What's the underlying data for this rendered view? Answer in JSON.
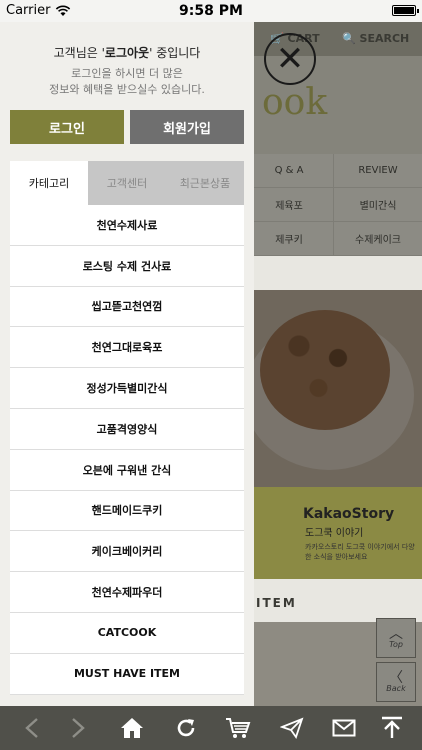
{
  "status_bar": {
    "carrier": "Carrier",
    "time": "9:58 PM"
  },
  "background_site": {
    "topbar": {
      "cart": "CART",
      "search": "SEARCH"
    },
    "logo": "ook",
    "nav_rows": [
      [
        "Q & A",
        "REVIEW"
      ],
      [
        "제육포",
        "별미간식"
      ],
      [
        "제쿠키",
        "수제케이크"
      ]
    ],
    "kakao": {
      "title": "KakaoStory",
      "subtitle": "도그쿡 이야기",
      "note": "카카오스토리 도그쿡 이야기에서 다양한 소식을 받아보세요"
    },
    "item_heading": "ITEM",
    "side_buttons": {
      "top": "Top",
      "back": "Back"
    }
  },
  "drawer": {
    "message_prefix": "고객님은 '",
    "message_bold": "로그아웃",
    "message_suffix": "' 중입니다",
    "sub_line1": "로그인을 하시면 더 많은",
    "sub_line2": "정보와 혜택을 받으실수 있습니다.",
    "login_label": "로그인",
    "join_label": "회원가입",
    "tabs": [
      {
        "label": "카테고리",
        "active": true
      },
      {
        "label": "고객센터",
        "active": false
      },
      {
        "label": "최근본상품",
        "active": false
      }
    ],
    "menu": [
      "천연수제사료",
      "로스팅 수제 건사료",
      "씹고뜯고천연껌",
      "천연그대로육포",
      "정성가득별미간식",
      "고품격영양식",
      "오븐에 구워낸 간식",
      "핸드메이드쿠키",
      "케이크베이커리",
      "천연수제파우더",
      "CATCOOK",
      "MUST HAVE ITEM"
    ]
  },
  "toolbar": {
    "icons": [
      "back-arrow",
      "forward-arrow",
      "home",
      "refresh",
      "cart",
      "share",
      "mail",
      "scroll-top"
    ]
  },
  "colors": {
    "accent": "#7f803a",
    "join": "#6f6f6f",
    "toolbar": "#50504a"
  }
}
